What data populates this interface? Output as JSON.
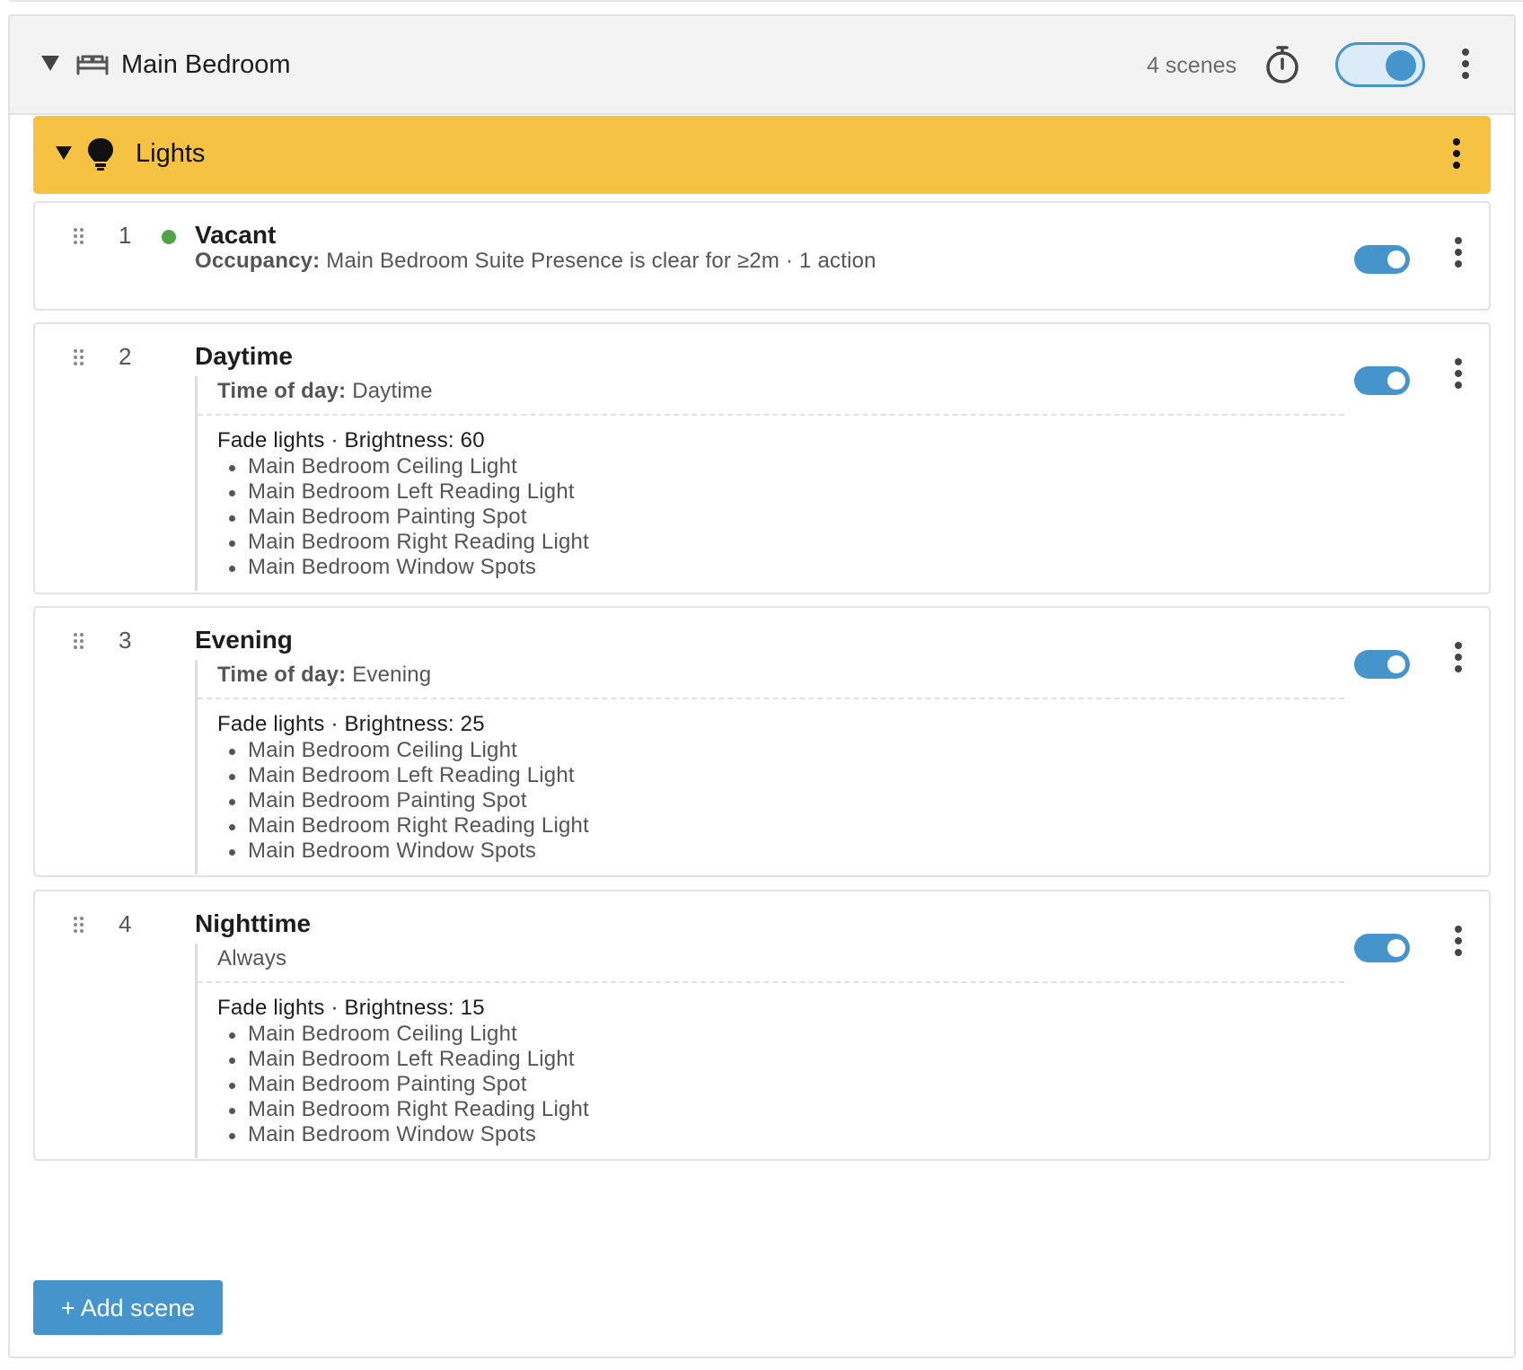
{
  "room": {
    "name": "Main Bedroom",
    "scene_count": "4 scenes",
    "enabled": true
  },
  "group": {
    "name": "Lights",
    "color": "#f6c244"
  },
  "scenes": [
    {
      "number": "1",
      "name": "Vacant",
      "active": true,
      "summary_label": "Occupancy:",
      "summary_text": "Main Bedroom Suite Presence is clear for ≥2m · 1 action",
      "enabled": true
    },
    {
      "number": "2",
      "name": "Daytime",
      "condition_label": "Time of day:",
      "condition_value": "Daytime",
      "action": "Fade lights · Brightness: 60",
      "devices": [
        "Main Bedroom Ceiling Light",
        "Main Bedroom Left Reading Light",
        "Main Bedroom Painting Spot",
        "Main Bedroom Right Reading Light",
        "Main Bedroom Window Spots"
      ],
      "enabled": true
    },
    {
      "number": "3",
      "name": "Evening",
      "condition_label": "Time of day:",
      "condition_value": "Evening",
      "action": "Fade lights · Brightness: 25",
      "devices": [
        "Main Bedroom Ceiling Light",
        "Main Bedroom Left Reading Light",
        "Main Bedroom Painting Spot",
        "Main Bedroom Right Reading Light",
        "Main Bedroom Window Spots"
      ],
      "enabled": true
    },
    {
      "number": "4",
      "name": "Nighttime",
      "condition_label": "",
      "condition_value": "Always",
      "action": "Fade lights · Brightness: 15",
      "devices": [
        "Main Bedroom Ceiling Light",
        "Main Bedroom Left Reading Light",
        "Main Bedroom Painting Spot",
        "Main Bedroom Right Reading Light",
        "Main Bedroom Window Spots"
      ],
      "enabled": true
    }
  ],
  "add_scene_label": "+ Add scene",
  "icons": {
    "collapse": "caret-down-icon",
    "room": "bed-icon",
    "timer": "stopwatch-icon",
    "group": "lightbulb-icon",
    "menu": "kebab-menu-icon",
    "drag": "drag-handle-icon"
  },
  "colors": {
    "accent": "#4595cc",
    "active_dot": "#4fa447"
  }
}
